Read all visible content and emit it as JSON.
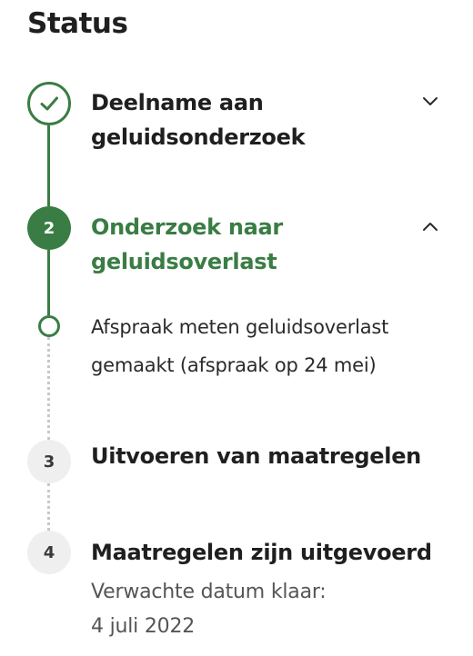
{
  "page": {
    "title": "Status"
  },
  "colors": {
    "accent": "#3a7d44",
    "pending": "#efefef",
    "text": "#1f1f1f"
  },
  "steps": [
    {
      "marker": "check-icon",
      "title_line1": "Deelname aan",
      "title_line2": "geluidsonderzoek",
      "state": "done",
      "toggle": "chevron-down-icon"
    },
    {
      "number": "2",
      "title_line1": "Onderzoek naar",
      "title_line2": "geluidsoverlast",
      "state": "active",
      "toggle": "chevron-up-icon",
      "substep": {
        "line1": "Afspraak meten geluidsoverlast",
        "line2": "gemaakt (afspraak op 24 mei)"
      }
    },
    {
      "number": "3",
      "title": "Uitvoeren van maatregelen",
      "state": "pending"
    },
    {
      "number": "4",
      "title": "Maatregelen zijn uitgevoerd",
      "subtitle_line1": "Verwachte datum klaar:",
      "subtitle_line2": "4 juli 2022",
      "state": "pending"
    }
  ]
}
